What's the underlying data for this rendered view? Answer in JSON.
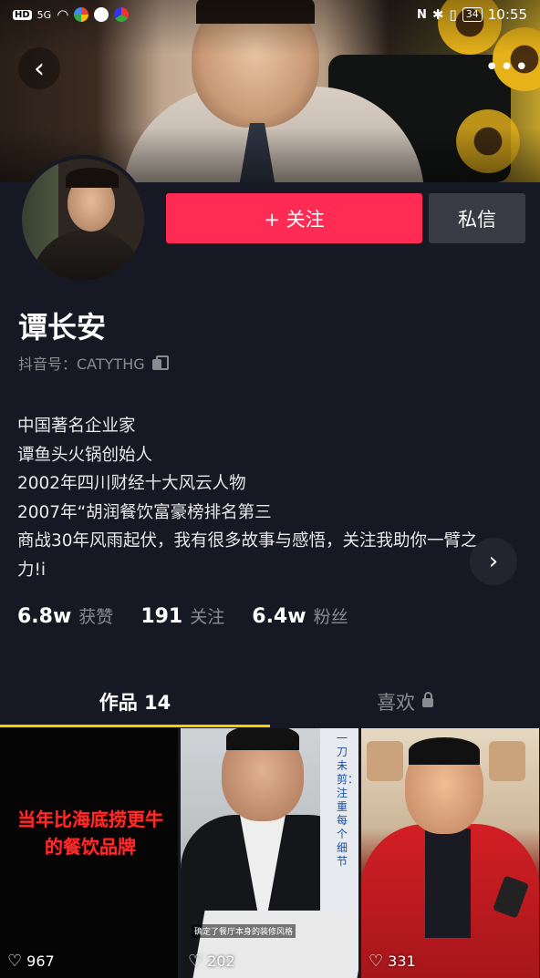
{
  "status_bar": {
    "network_badge": "HD",
    "signal": "5G",
    "battery": "34",
    "time": "10:55"
  },
  "header": {
    "back_icon": "chevron-left-icon",
    "more_icon": "more-dots-icon"
  },
  "profile": {
    "name": "谭长安",
    "douyin_id": "抖音号：CATYTHG",
    "follow_label": "+ 关注",
    "message_label": "私信",
    "bio": [
      "中国著名企业家",
      "谭鱼头火锅创始人",
      "2002年四川财经十大风云人物",
      "2007年“胡润餐饮富豪榜排名第三",
      "商战30年风雨起伏，我有很多故事与感悟，关注我助你一臂之力!i"
    ],
    "stats": {
      "likes_value": "6.8w",
      "likes_label": "获赞",
      "following_value": "191",
      "following_label": "关注",
      "fans_value": "6.4w",
      "fans_label": "粉丝"
    }
  },
  "tabs": {
    "works": "作品 14",
    "likes": "喜欢"
  },
  "videos": [
    {
      "caption": "当年比海底捞更牛的餐饮品牌",
      "likes": "967"
    },
    {
      "caption": "一刀未剪：注重每个细节",
      "subtitle": "确定了餐厅本身的装修风格",
      "likes": "202"
    },
    {
      "likes": "331"
    }
  ],
  "colors": {
    "background": "#161823",
    "follow_button": "#fe2c55",
    "message_button": "#393b44",
    "tab_indicator": "#facd00",
    "muted_text": "#8a8b91"
  }
}
